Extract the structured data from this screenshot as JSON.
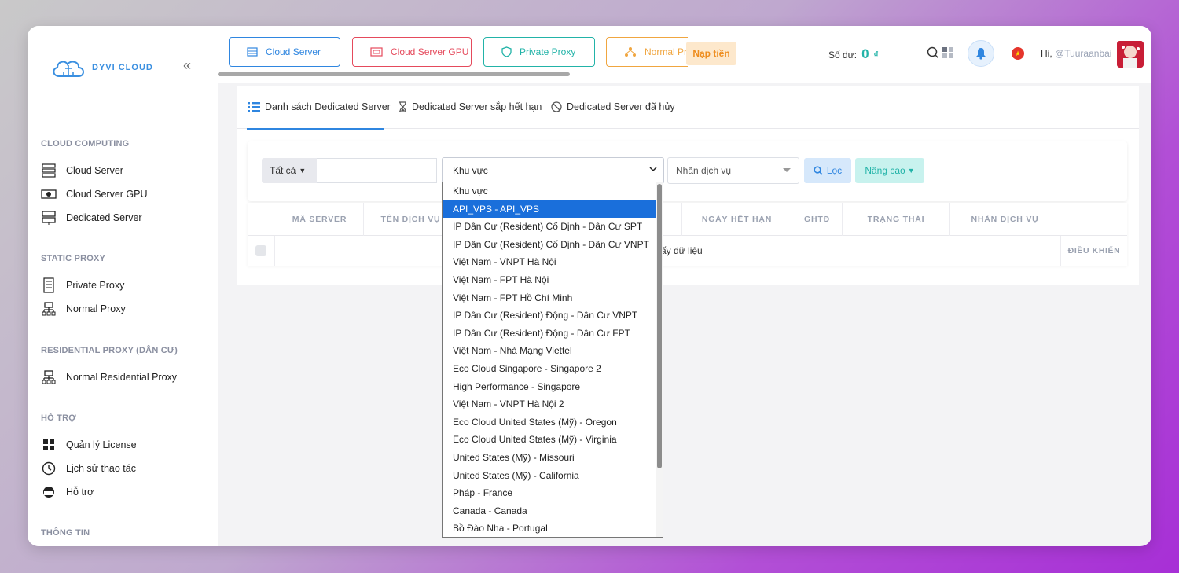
{
  "sidebar": {
    "logo_text": "DYVI CLOUD",
    "collapse_icon": "double-chevron-left-icon",
    "sections": [
      {
        "title": "CLOUD COMPUTING",
        "items": [
          {
            "label": "Cloud Server",
            "icon": "server-rack-icon"
          },
          {
            "label": "Cloud Server GPU",
            "icon": "gpu-icon"
          },
          {
            "label": "Dedicated Server",
            "icon": "dedicated-server-icon"
          }
        ]
      },
      {
        "title": "STATIC PROXY",
        "items": [
          {
            "label": "Private Proxy",
            "icon": "document-icon"
          },
          {
            "label": "Normal Proxy",
            "icon": "network-icon"
          }
        ]
      },
      {
        "title": "RESIDENTIAL PROXY (DÂN CƯ)",
        "items": [
          {
            "label": "Normal Residential Proxy",
            "icon": "network-icon"
          }
        ]
      },
      {
        "title": "HỖ TRỢ",
        "items": [
          {
            "label": "Quản lý License",
            "icon": "windows-icon"
          },
          {
            "label": "Lịch sử thao tác",
            "icon": "history-icon"
          },
          {
            "label": "Hỗ trợ",
            "icon": "headset-icon"
          }
        ]
      },
      {
        "title": "THÔNG TIN",
        "items": []
      }
    ]
  },
  "topbar": {
    "tabs": [
      {
        "label": "Cloud Server",
        "color": "#2f86e0"
      },
      {
        "label": "Cloud Server GPU",
        "color": "#e54a5c"
      },
      {
        "label": "Private Proxy",
        "color": "#22b3a8"
      },
      {
        "label": "Normal Pr",
        "color": "#f0a640"
      }
    ],
    "topup_label": "Nạp tiền",
    "balance_label": "Số dư:",
    "balance_value": "0",
    "currency": "₫",
    "greeting": "Hi,",
    "username": "@Tuuraanbai"
  },
  "subtabs": [
    {
      "label": "Danh sách Dedicated Server",
      "icon": "list-icon"
    },
    {
      "label": "Dedicated Server sắp hết hạn",
      "icon": "hourglass-icon"
    },
    {
      "label": "Dedicated Server đã hủy",
      "icon": "ban-icon"
    }
  ],
  "filter": {
    "scope_label": "Tất cả",
    "search_value": "",
    "region_select": "Khu vực",
    "tag_select": "Nhãn dịch vụ",
    "filter_button": "Lọc",
    "advanced_button": "Nâng cao"
  },
  "table": {
    "columns": [
      "MÃ SERVER",
      "TÊN DỊCH VỤ",
      "",
      "NGÀY HẾT HẠN",
      "GHTĐ",
      "TRẠNG THÁI",
      "NHÃN DỊCH VỤ"
    ],
    "empty_text": "ấy dữ liệu",
    "actions_header": "ĐIỀU KHIỂN"
  },
  "region_options": [
    "Khu vực",
    "API_VPS - API_VPS",
    "IP Dân Cư (Resident) Cố Định - Dân Cư SPT",
    "IP Dân Cư (Resident) Cố Định - Dân Cư VNPT",
    "Việt Nam - VNPT Hà Nội",
    "Việt Nam - FPT Hà Nội",
    "Việt Nam - FPT Hồ Chí Minh",
    "IP Dân Cư (Resident) Động - Dân Cư VNPT",
    "IP Dân Cư (Resident) Động - Dân Cư FPT",
    "Việt Nam - Nhà Mạng Viettel",
    "Eco Cloud Singapore - Singapore 2",
    "High Performance - Singapore",
    "Việt Nam - VNPT Hà Nội 2",
    "Eco Cloud United States (Mỹ) - Oregon",
    "Eco Cloud United States (Mỹ) - Virginia",
    "United States (Mỹ) - Missouri",
    "United States (Mỹ) - California",
    "Pháp - France",
    "Canada - Canada",
    "Bồ Đào Nha - Portugal"
  ],
  "selected_option": "API_VPS - API_VPS",
  "colors": {
    "accent": "#2f86e0",
    "teal": "#22b3a8",
    "highlight": "#1a6fdb"
  }
}
